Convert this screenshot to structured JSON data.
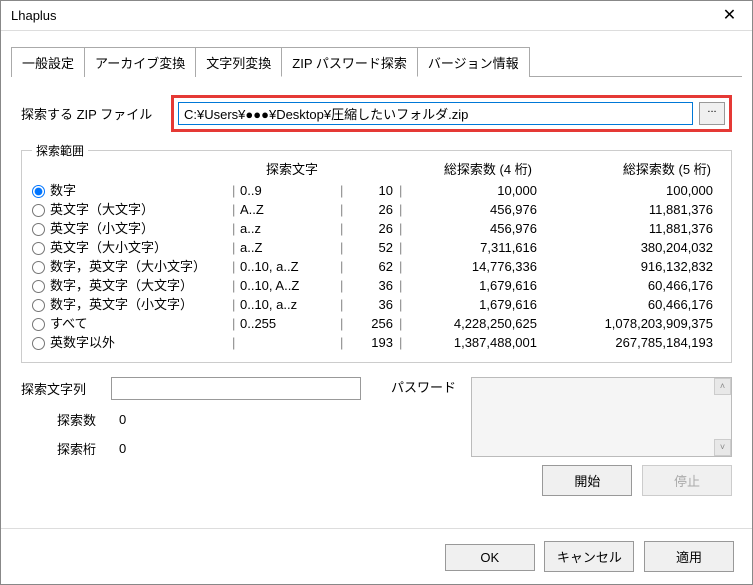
{
  "window": {
    "title": "Lhaplus"
  },
  "tabs": [
    "一般設定",
    "アーカイブ変換",
    "文字列変換",
    "ZIP パスワード探索",
    "バージョン情報"
  ],
  "active_tab": 3,
  "file": {
    "label": "探索する ZIP ファイル",
    "value": "C:¥Users¥●●●¥Desktop¥圧縮したいフォルダ.zip",
    "browse": "..."
  },
  "range": {
    "legend": "探索範囲",
    "headers": {
      "chars": "探索文字",
      "n4": "総探索数 (4 桁)",
      "n5": "総探索数 (5 桁)"
    },
    "rows": [
      {
        "label": "数字",
        "chars": "0..9",
        "digs": "10",
        "n4": "10,000",
        "n5": "100,000"
      },
      {
        "label": "英文字（大文字）",
        "chars": "A..Z",
        "digs": "26",
        "n4": "456,976",
        "n5": "11,881,376"
      },
      {
        "label": "英文字（小文字）",
        "chars": "a..z",
        "digs": "26",
        "n4": "456,976",
        "n5": "11,881,376"
      },
      {
        "label": "英文字（大小文字）",
        "chars": "a..Z",
        "digs": "52",
        "n4": "7,311,616",
        "n5": "380,204,032"
      },
      {
        "label": "数字，英文字（大小文字）",
        "chars": "0..10, a..Z",
        "digs": "62",
        "n4": "14,776,336",
        "n5": "916,132,832"
      },
      {
        "label": "数字，英文字（大文字）",
        "chars": "0..10, A..Z",
        "digs": "36",
        "n4": "1,679,616",
        "n5": "60,466,176"
      },
      {
        "label": "数字，英文字（小文字）",
        "chars": "0..10, a..z",
        "digs": "36",
        "n4": "1,679,616",
        "n5": "60,466,176"
      },
      {
        "label": "すべて",
        "chars": "0..255",
        "digs": "256",
        "n4": "4,228,250,625",
        "n5": "1,078,203,909,375"
      },
      {
        "label": "英数字以外",
        "chars": "",
        "digs": "193",
        "n4": "1,387,488,001",
        "n5": "267,785,184,193"
      }
    ],
    "selected": 0
  },
  "search": {
    "string_label": "探索文字列",
    "count_label": "探索数",
    "count_val": "0",
    "digits_label": "探索桁",
    "digits_val": "0",
    "password_label": "パスワード",
    "start": "開始",
    "stop": "停止"
  },
  "footer": {
    "ok": "OK",
    "cancel": "キャンセル",
    "apply": "適用"
  }
}
